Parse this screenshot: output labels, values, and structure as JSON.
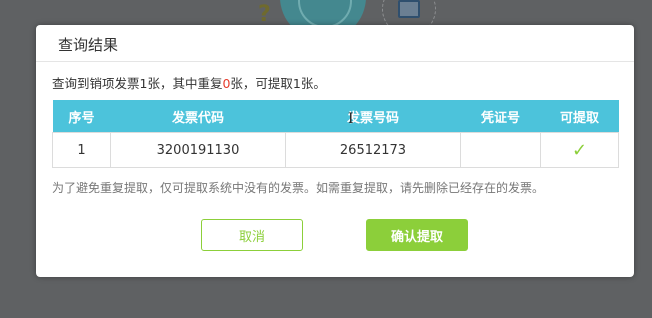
{
  "dialog": {
    "title": "查询结果",
    "summary": {
      "prefix": "查询到销项发票1张，其中重复",
      "duplicate_count": "0",
      "suffix": "张，可提取1张。"
    },
    "table": {
      "headers": [
        "序号",
        "发票代码",
        "发票号码",
        "凭证号",
        "可提取"
      ],
      "rows": [
        {
          "index": "1",
          "invoice_code": "3200191130",
          "invoice_number": "26512173",
          "voucher_no": "",
          "extractable_icon": "checkmark-icon"
        }
      ]
    },
    "note": "为了避免重复提取，仅可提取系统中没有的发票。如需重复提取，请先删除已经存在的发票。",
    "cancel_label": "取消",
    "confirm_label": "确认提取"
  },
  "colors": {
    "accent": "#8ccf3a",
    "table_header": "#4cc3db",
    "highlight_red": "#e63c2c",
    "overlay": "#5f6163"
  }
}
